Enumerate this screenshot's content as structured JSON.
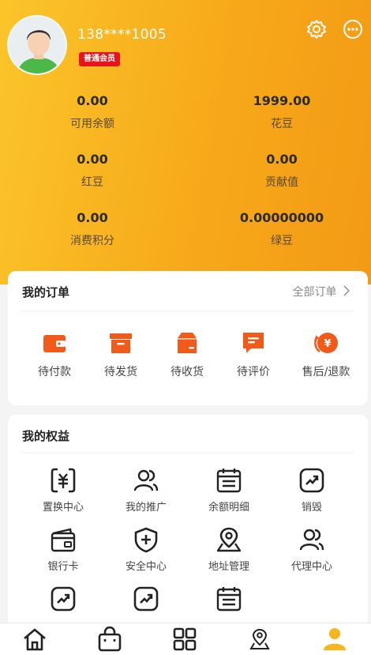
{
  "profile": {
    "phone": "138****1005",
    "level_badge": "普通会员",
    "avatar_icon": "user-avatar-icon"
  },
  "header_icons": [
    "settings-icon",
    "more-icon"
  ],
  "stats": [
    {
      "value": "0.00",
      "label": "可用余额"
    },
    {
      "value": "1999.00",
      "label": "花豆"
    },
    {
      "value": "0.00",
      "label": "红豆"
    },
    {
      "value": "0.00",
      "label": "贡献值"
    },
    {
      "value": "0.00",
      "label": "消费积分"
    },
    {
      "value": "0.00000000",
      "label": "绿豆"
    }
  ],
  "orders": {
    "title": "我的订单",
    "all_link": "全部订单",
    "items": [
      {
        "label": "待付款",
        "icon": "wallet-icon"
      },
      {
        "label": "待发货",
        "icon": "box-icon"
      },
      {
        "label": "待收货",
        "icon": "package-icon"
      },
      {
        "label": "待评价",
        "icon": "comment-icon"
      },
      {
        "label": "售后/退款",
        "icon": "refund-icon"
      }
    ]
  },
  "rights": {
    "title": "我的权益",
    "items": [
      {
        "label": "置换中心",
        "icon": "exchange-icon"
      },
      {
        "label": "我的推广",
        "icon": "users-icon"
      },
      {
        "label": "余额明细",
        "icon": "calendar-icon"
      },
      {
        "label": "销毁",
        "icon": "trend-icon"
      },
      {
        "label": "银行卡",
        "icon": "card-wallet-icon"
      },
      {
        "label": "安全中心",
        "icon": "shield-plus-icon"
      },
      {
        "label": "地址管理",
        "icon": "map-pin-icon"
      },
      {
        "label": "代理中心",
        "icon": "users-icon"
      },
      {
        "label": "",
        "icon": "trend-icon"
      },
      {
        "label": "",
        "icon": "trend-icon"
      },
      {
        "label": "",
        "icon": "calendar-icon"
      }
    ]
  },
  "tabbar": [
    "home-icon",
    "bag-icon",
    "grid-icon",
    "location-icon",
    "profile-icon"
  ],
  "colors": {
    "header_start": "#fbc52a",
    "header_end": "#f39a15",
    "badge": "#e8141c",
    "order_icon": "#f25a1a",
    "tab_active": "#f8b51c"
  }
}
